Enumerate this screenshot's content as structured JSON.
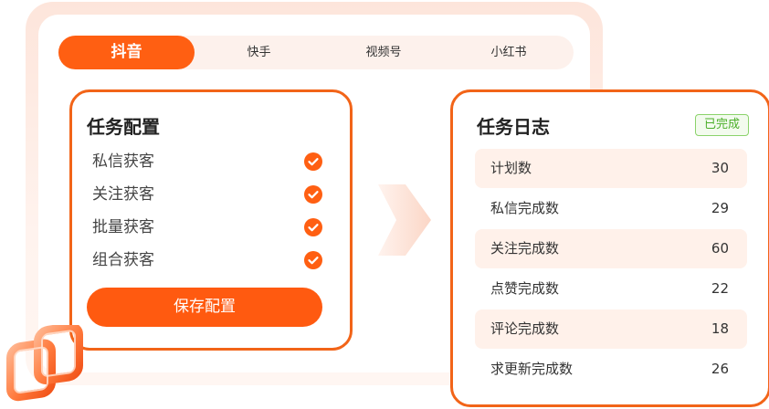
{
  "tabs": [
    {
      "label": "抖音",
      "active": true
    },
    {
      "label": "快手",
      "active": false
    },
    {
      "label": "视频号",
      "active": false
    },
    {
      "label": "小红书",
      "active": false
    }
  ],
  "config": {
    "title": "任务配置",
    "items": [
      {
        "label": "私信获客",
        "checked": true
      },
      {
        "label": "关注获客",
        "checked": true
      },
      {
        "label": "批量获客",
        "checked": true
      },
      {
        "label": "组合获客",
        "checked": true
      }
    ],
    "save_label": "保存配置"
  },
  "log": {
    "title": "任务日志",
    "status": "已完成",
    "rows": [
      {
        "label": "计划数",
        "value": "30"
      },
      {
        "label": "私信完成数",
        "value": "29"
      },
      {
        "label": "关注完成数",
        "value": "60"
      },
      {
        "label": "点赞完成数",
        "value": "22"
      },
      {
        "label": "评论完成数",
        "value": "18"
      },
      {
        "label": "求更新完成数",
        "value": "26"
      }
    ]
  },
  "colors": {
    "accent": "#ff5f12",
    "card_border": "#f26418",
    "row_shade": "#fff1ea",
    "success": "#4caf2a"
  },
  "icons": {
    "check": "check-circle-icon",
    "arrow": "arrow-right-icon",
    "logo": "brand-logo-icon"
  }
}
